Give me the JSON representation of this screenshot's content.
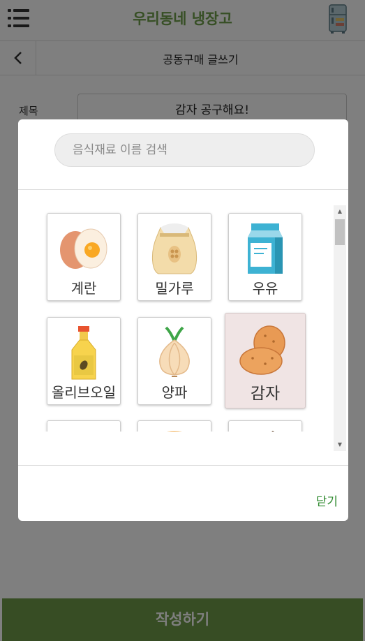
{
  "header": {
    "title": "우리동네 냉장고"
  },
  "subheader": {
    "title": "공동구매 글쓰기"
  },
  "form": {
    "title_label": "제목",
    "title_value": "감자 공구해요!",
    "submit_label": "작성하기"
  },
  "modal": {
    "search_placeholder": "음식재료 이름 검색",
    "close_label": "닫기",
    "items": [
      {
        "label": "계란",
        "icon": "egg-icon"
      },
      {
        "label": "밀가루",
        "icon": "flour-icon"
      },
      {
        "label": "우유",
        "icon": "milk-icon"
      },
      {
        "label": "올리브오일",
        "icon": "olive-oil-icon"
      },
      {
        "label": "양파",
        "icon": "onion-icon"
      },
      {
        "label": "감자",
        "icon": "potato-icon",
        "selected": true
      },
      {
        "label": "",
        "icon": "sugar-icon"
      },
      {
        "label": "",
        "icon": "sweet-potato-icon"
      },
      {
        "label": "",
        "icon": "chopsticks-icon"
      }
    ]
  },
  "colors": {
    "brand_green": "#6f9f4a",
    "submit_green": "#6e9b48",
    "close_green": "#2f8a2f",
    "selected_tile": "#f0e4e4"
  }
}
